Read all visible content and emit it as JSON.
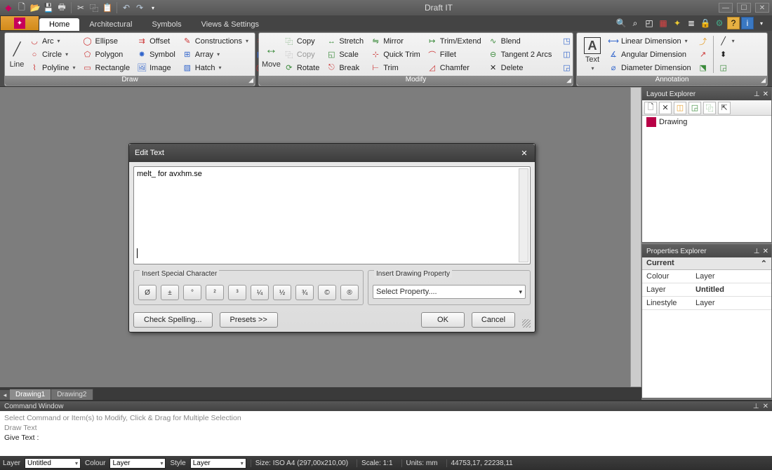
{
  "app": {
    "title": "Draft IT"
  },
  "tabs": {
    "home": "Home",
    "architectural": "Architectural",
    "symbols": "Symbols",
    "views": "Views & Settings"
  },
  "panels": {
    "draw": {
      "title": "Draw",
      "line": "Line",
      "arc": "Arc",
      "circle": "Circle",
      "polyline": "Polyline",
      "ellipse": "Ellipse",
      "polygon": "Polygon",
      "rectangle": "Rectangle",
      "offset": "Offset",
      "symbol": "Symbol",
      "image": "Image",
      "constructions": "Constructions",
      "array": "Array",
      "hatch": "Hatch"
    },
    "modify": {
      "title": "Modify",
      "move": "Move",
      "copy": "Copy",
      "copy2": "Copy",
      "rotate": "Rotate",
      "stretch": "Stretch",
      "scale": "Scale",
      "break": "Break",
      "mirror": "Mirror",
      "quicktrim": "Quick Trim",
      "trim": "Trim",
      "trimextend": "Trim/Extend",
      "fillet": "Fillet",
      "chamfer": "Chamfer",
      "blend": "Blend",
      "tangent2arcs": "Tangent 2 Arcs",
      "delete": "Delete"
    },
    "annotation": {
      "title": "Annotation",
      "text": "Text",
      "linear": "Linear Dimension",
      "angular": "Angular Dimension",
      "diameter": "Diameter Dimension"
    }
  },
  "layout_explorer": {
    "title": "Layout Explorer",
    "item": "Drawing"
  },
  "properties_explorer": {
    "title": "Properties Explorer",
    "section": "Current",
    "rows": {
      "colour_k": "Colour",
      "colour_v": "Layer",
      "layer_k": "Layer",
      "layer_v": "Untitled",
      "linestyle_k": "Linestyle",
      "linestyle_v": "Layer"
    }
  },
  "dialog": {
    "title": "Edit Text",
    "text": "melt_ for avxhm.se",
    "special_legend": "Insert Special Character",
    "specials": [
      "Ø",
      "±",
      "°",
      "²",
      "³",
      "¼",
      "½",
      "¾",
      "©",
      "®"
    ],
    "property_legend": "Insert Drawing Property",
    "property_placeholder": "Select Property....",
    "check_spelling": "Check Spelling...",
    "presets": "Presets  >>",
    "ok": "OK",
    "cancel": "Cancel"
  },
  "drawings": {
    "d1": "Drawing1",
    "d2": "Drawing2"
  },
  "cmd": {
    "title": "Command Window",
    "l1": "Select Command or Item(s) to Modify, Click & Drag for Multiple Selection",
    "l2": "Draw Text",
    "l3": "Give Text :"
  },
  "status": {
    "layer_lbl": "Layer",
    "layer_val": "Untitled",
    "colour_lbl": "Colour",
    "colour_val": "Layer",
    "style_lbl": "Style",
    "style_val": "Layer",
    "size": "Size: ISO A4 (297,00x210,00)",
    "scale": "Scale: 1:1",
    "units": "Units: mm",
    "coords": "44753,17, 22238,11"
  }
}
